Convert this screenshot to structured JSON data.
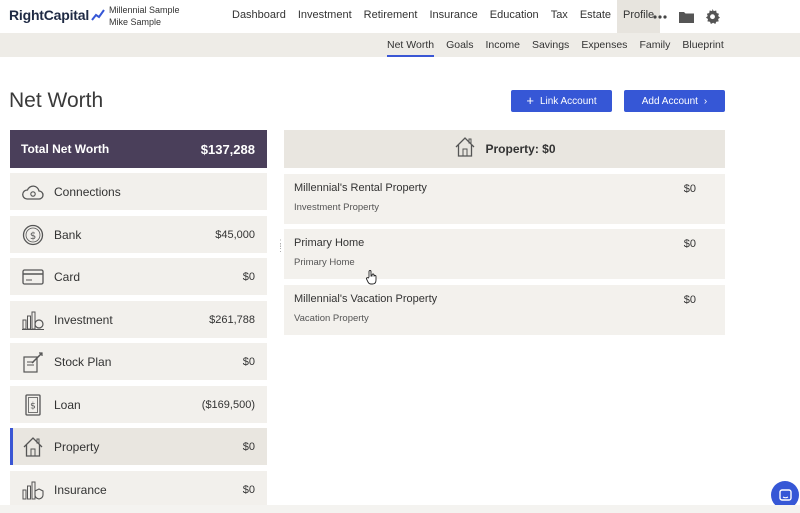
{
  "header": {
    "logo_text": "RightCapital",
    "client_line1": "Millennial Sample",
    "client_line2": "Mike Sample",
    "nav": [
      "Dashboard",
      "Investment",
      "Retirement",
      "Insurance",
      "Education",
      "Tax",
      "Estate",
      "Profile"
    ],
    "active_nav": "Profile",
    "icons": [
      "more-icon",
      "folder-icon",
      "gear-icon"
    ]
  },
  "subnav": {
    "items": [
      "Net Worth",
      "Goals",
      "Income",
      "Savings",
      "Expenses",
      "Family",
      "Blueprint"
    ],
    "active": "Net Worth"
  },
  "page": {
    "title": "Net Worth",
    "link_account_label": "Link Account",
    "add_account_label": "Add Account"
  },
  "sidebar": {
    "total_label": "Total Net Worth",
    "total_value": "$137,288",
    "items": [
      {
        "label": "Connections",
        "amount": "",
        "icon": "cloud-icon"
      },
      {
        "label": "Bank",
        "amount": "$45,000",
        "icon": "dollar-coin-icon"
      },
      {
        "label": "Card",
        "amount": "$0",
        "icon": "credit-card-icon"
      },
      {
        "label": "Investment",
        "amount": "$261,788",
        "icon": "investment-chart-icon"
      },
      {
        "label": "Stock Plan",
        "amount": "$0",
        "icon": "stock-plan-icon"
      },
      {
        "label": "Loan",
        "amount": "($169,500)",
        "icon": "loan-document-icon"
      },
      {
        "label": "Property",
        "amount": "$0",
        "icon": "house-icon"
      },
      {
        "label": "Insurance",
        "amount": "$0",
        "icon": "insurance-icon"
      }
    ],
    "active_item": "Property"
  },
  "property": {
    "header_title": "Property: $0",
    "rows": [
      {
        "name": "Millennial's Rental Property",
        "type": "Investment Property",
        "amount": "$0"
      },
      {
        "name": "Primary Home",
        "type": "Primary Home",
        "amount": "$0"
      },
      {
        "name": "Millennial's Vacation Property",
        "type": "Vacation Property",
        "amount": "$0"
      }
    ]
  },
  "colors": {
    "accent": "#3657d6",
    "total_bg": "#4a3f5a",
    "row_bg": "#f3f1ed"
  }
}
